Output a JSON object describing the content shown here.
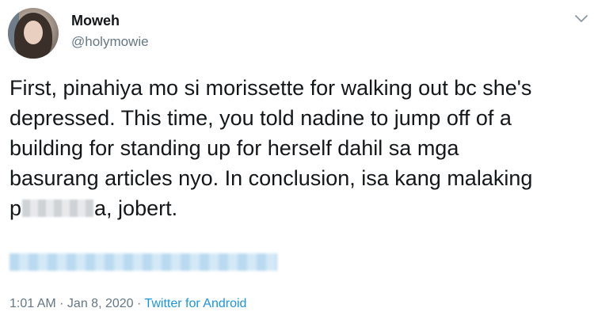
{
  "user": {
    "display_name": "Moweh",
    "handle": "@holymowie"
  },
  "tweet": {
    "text_line1": "First, pinahiya mo si morissette for walking out bc she's",
    "text_line2": "depressed. This time, you told nadine to jump off of a",
    "text_line3": "building for standing up for herself dahil sa mga",
    "text_line4": "basurang articles nyo. In conclusion, isa kang malaking",
    "text_line5_start": "p",
    "text_line5_end": "a, jobert."
  },
  "meta": {
    "time": "1:01 AM",
    "separator1": " · ",
    "date": "Jan 8, 2020",
    "separator2": " · ",
    "source": "Twitter for Android"
  },
  "icons": {
    "menu": "chevron-down-icon"
  },
  "colors": {
    "text": "#14171a",
    "secondary": "#657786",
    "link": "#1b95e0"
  }
}
